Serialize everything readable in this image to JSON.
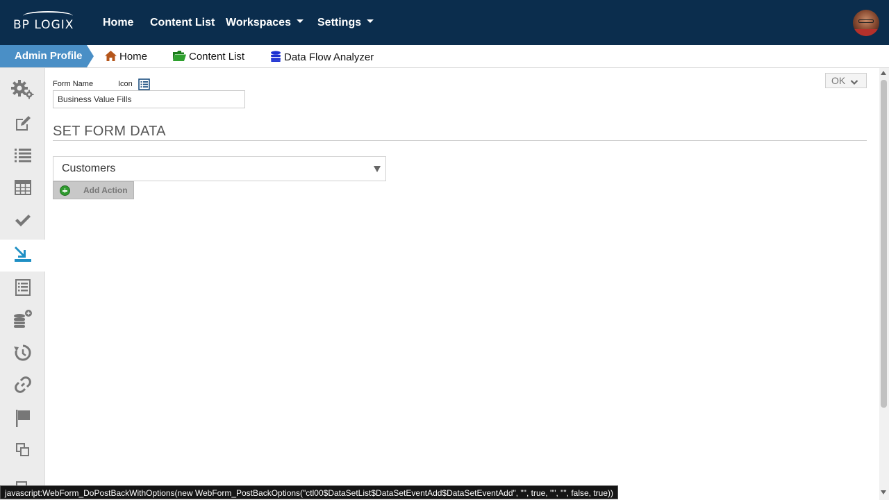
{
  "header": {
    "logo_text": "BP LOGIX",
    "nav": [
      {
        "label": "Home"
      },
      {
        "label": "Content List"
      },
      {
        "label": "Workspaces"
      },
      {
        "label": "Settings"
      }
    ]
  },
  "breadcrumb": {
    "profile": "Admin Profile",
    "items": [
      {
        "label": "Home",
        "icon": "home-icon"
      },
      {
        "label": "Content List",
        "icon": "folder-icon"
      },
      {
        "label": "Data Flow Analyzer",
        "icon": "database-icon"
      }
    ]
  },
  "sidebar": {
    "items": [
      "gears-icon",
      "edit-icon",
      "list-icon",
      "table-icon",
      "check-icon",
      "import-icon",
      "form-list-icon",
      "database-add-icon",
      "history-icon",
      "link-icon",
      "flag-icon",
      "copy-icon"
    ],
    "active": "import-icon"
  },
  "form": {
    "form_name_label": "Form Name",
    "icon_label": "Icon",
    "form_name_value": "Business Value Fills",
    "ok_label": "OK"
  },
  "section": {
    "title": "SET FORM DATA",
    "dataset_selected": "Customers",
    "add_action_label": "Add Action"
  },
  "status": {
    "text": "javascript:WebForm_DoPostBackWithOptions(new WebForm_PostBackOptions(\"ctl00$DataSetList$DataSetEventAdd$DataSetEventAdd\", \"\", true, \"\", \"\", false, true))"
  },
  "colors": {
    "navbar": "#0b2d4d",
    "profile_tab": "#4a8fc6",
    "accent_icon": "#1f8fc4"
  }
}
